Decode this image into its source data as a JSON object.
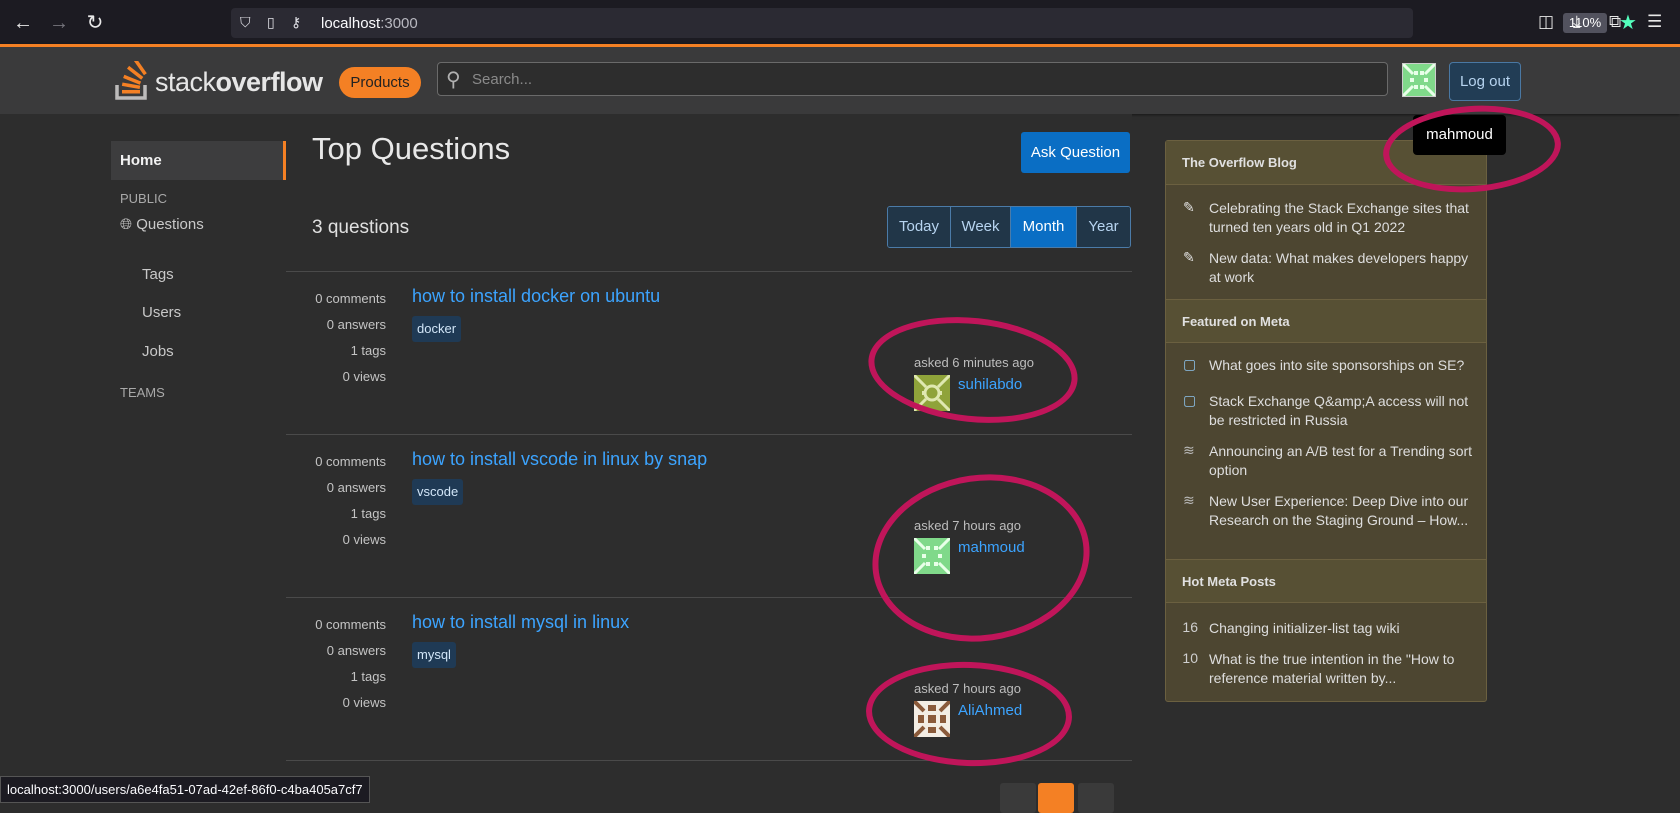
{
  "browser": {
    "url_host": "localhost",
    "url_port": ":3000",
    "zoom": "110%",
    "status_url": "localhost:3000/users/a6e4fa51-07ad-42ef-86f0-c4ba405a7cf7"
  },
  "header": {
    "logo_light": "stack",
    "logo_bold": "overflow",
    "products_label": "Products",
    "search_placeholder": "Search...",
    "logout_label": "Log out",
    "tooltip": "mahmoud"
  },
  "sidebar": {
    "home": "Home",
    "public": "PUBLIC",
    "questions": "Questions",
    "tags": "Tags",
    "users": "Users",
    "jobs": "Jobs",
    "teams": "TEAMS"
  },
  "main": {
    "title": "Top Questions",
    "ask_label": "Ask Question",
    "count": "3 questions",
    "filters": [
      "Today",
      "Week",
      "Month",
      "Year"
    ],
    "active_filter": "Month",
    "questions": [
      {
        "comments": "0 comments",
        "answers": "0 answers",
        "tags_count": "1 tags",
        "views": "0 views",
        "title": "how to install docker on ubuntu",
        "tag": "docker",
        "asked": "asked 6 minutes ago",
        "user": "suhilabdo",
        "avatar_color": "#8fa33a"
      },
      {
        "comments": "0 comments",
        "answers": "0 answers",
        "tags_count": "1 tags",
        "views": "0 views",
        "title": "how to install vscode in linux by snap",
        "tag": "vscode",
        "asked": "asked 7 hours ago",
        "user": "mahmoud",
        "avatar_color": "#80d98a"
      },
      {
        "comments": "0 comments",
        "answers": "0 answers",
        "tags_count": "1 tags",
        "views": "0 views",
        "title": "how to install mysql in linux",
        "tag": "mysql",
        "asked": "asked 7 hours ago",
        "user": "AliAhmed",
        "avatar_color": "#8a5a3a"
      }
    ]
  },
  "blog": {
    "overflow_header": "The Overflow Blog",
    "overflow_items": [
      "Celebrating the Stack Exchange sites that turned ten years old in Q1 2022",
      "New data: What makes developers happy at work"
    ],
    "meta_header": "Featured on Meta",
    "meta_items": [
      "What goes into site sponsorships on SE?",
      "Stack Exchange Q&amp;A access will not be restricted in Russia",
      "Announcing an A/B test for a Trending sort option",
      "New User Experience: Deep Dive into our Research on the Staging Ground – How..."
    ],
    "hot_header": "Hot Meta Posts",
    "hot_items": [
      {
        "num": "16",
        "text": "Changing initializer-list tag wiki"
      },
      {
        "num": "10",
        "text": "What is the true intention in the \"How to reference material written by..."
      }
    ]
  },
  "colors": {
    "accent": "#f48024",
    "link": "#3ca4ff",
    "annotation": "#c0155a"
  }
}
